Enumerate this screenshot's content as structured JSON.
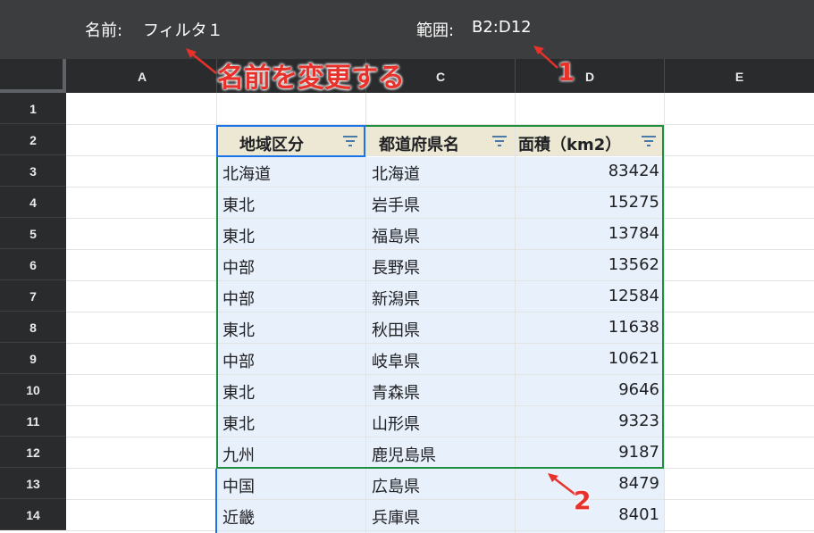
{
  "filter_bar": {
    "name_label": "名前:",
    "name_value": "フィルタ１",
    "range_label": "範囲:",
    "range_value": "B2:D12"
  },
  "columns": [
    "A",
    "",
    "C",
    "D",
    "E"
  ],
  "rows": [
    "1",
    "2",
    "3",
    "4",
    "5",
    "6",
    "7",
    "8",
    "9",
    "10",
    "11",
    "12",
    "13",
    "14"
  ],
  "table": {
    "headers": [
      "地域区分",
      "都道府県名",
      "面積（km2）"
    ],
    "data": [
      [
        "北海道",
        "北海道",
        "83424"
      ],
      [
        "東北",
        "岩手県",
        "15275"
      ],
      [
        "東北",
        "福島県",
        "13784"
      ],
      [
        "中部",
        "長野県",
        "13562"
      ],
      [
        "中部",
        "新潟県",
        "12584"
      ],
      [
        "東北",
        "秋田県",
        "11638"
      ],
      [
        "中部",
        "岐阜県",
        "10621"
      ],
      [
        "東北",
        "青森県",
        "9646"
      ],
      [
        "東北",
        "山形県",
        "9323"
      ],
      [
        "九州",
        "鹿児島県",
        "9187"
      ],
      [
        "中国",
        "広島県",
        "8479"
      ],
      [
        "近畿",
        "兵庫県",
        "8401"
      ]
    ]
  },
  "annotations": {
    "rename_callout": "名前を変更する",
    "marker_1": "1",
    "marker_2": "2",
    "accent_color": "#e8312b"
  },
  "colors": {
    "header_fill": "#ece8d3",
    "data_fill": "#e8f0fb",
    "filter_border": "#1e8e3e",
    "active_border": "#1a73e8"
  }
}
